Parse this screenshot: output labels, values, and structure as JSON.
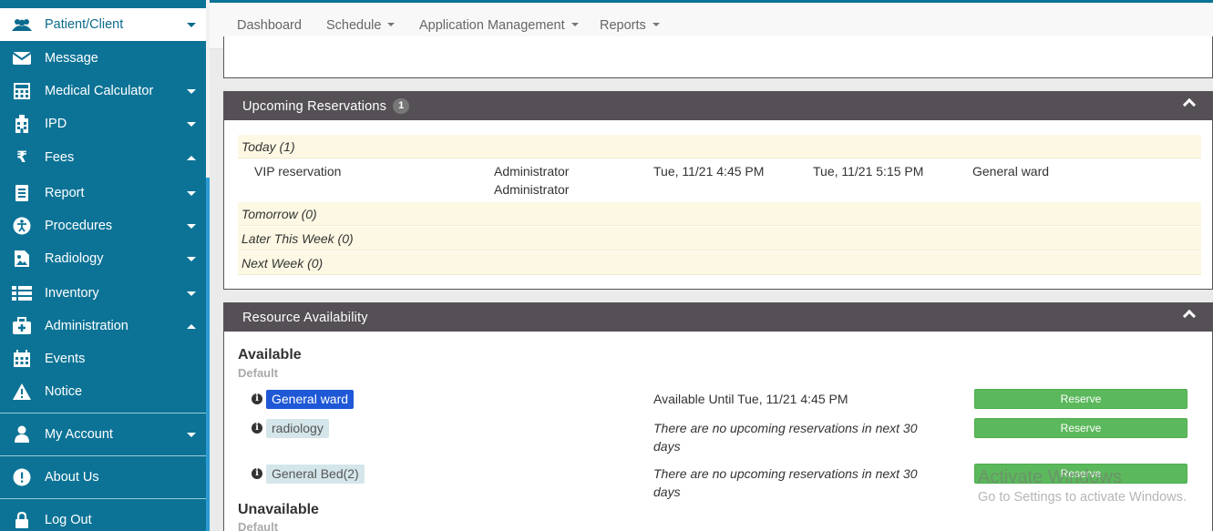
{
  "sidebar": {
    "items": [
      {
        "label": "Patient/Client",
        "icon": "users-icon",
        "caret": "down"
      },
      {
        "label": "Message",
        "icon": "envelope-icon",
        "caret": ""
      },
      {
        "label": "Medical Calculator",
        "icon": "calculator-icon",
        "caret": "down"
      },
      {
        "label": "IPD",
        "icon": "hospital-icon",
        "caret": "down"
      },
      {
        "label": "Fees",
        "icon": "rupee-icon",
        "caret": "up"
      },
      {
        "label": "Report",
        "icon": "book-icon",
        "caret": "down"
      },
      {
        "label": "Procedures",
        "icon": "accessibility-icon",
        "caret": "down"
      },
      {
        "label": "Radiology",
        "icon": "image-file-icon",
        "caret": "down"
      },
      {
        "label": "Inventory",
        "icon": "list-icon",
        "caret": "down"
      },
      {
        "label": "Administration",
        "icon": "medkit-icon",
        "caret": "up"
      },
      {
        "label": "Events",
        "icon": "calendar-icon",
        "caret": ""
      },
      {
        "label": "Notice",
        "icon": "warning-icon",
        "caret": ""
      },
      {
        "label": "My Account",
        "icon": "user-icon",
        "caret": "down"
      },
      {
        "label": "About Us",
        "icon": "info-circle-icon",
        "caret": ""
      },
      {
        "label": "Log Out",
        "icon": "lock-icon",
        "caret": ""
      }
    ]
  },
  "topnav": {
    "dashboard": "Dashboard",
    "schedule": "Schedule",
    "app_mgmt": "Application Management",
    "reports": "Reports"
  },
  "reservations": {
    "title": "Upcoming Reservations",
    "count": "1",
    "groups": {
      "today": "Today (1)",
      "tomorrow": "Tomorrow (0)",
      "later": "Later This Week (0)",
      "next": "Next Week (0)"
    },
    "row": {
      "name": "VIP reservation",
      "owner_line1": "Administrator",
      "owner_line2": "Administrator",
      "start": "Tue, 11/21 4:45 PM",
      "end": "Tue, 11/21 5:15 PM",
      "resource": "General ward"
    }
  },
  "availability": {
    "title": "Resource Availability",
    "available_heading": "Available",
    "available_sub": "Default",
    "unavailable_heading": "Unavailable",
    "unavailable_sub": "Default",
    "resources": [
      {
        "name": "General ward",
        "status": "Available Until Tue, 11/21 4:45 PM",
        "button": "Reserve"
      },
      {
        "name": "radiology",
        "status": "There are no upcoming reservations in next 30 days",
        "button": "Reserve"
      },
      {
        "name": "General Bed(2)",
        "status": "There are no upcoming reservations in next 30 days",
        "button": "Reserve"
      }
    ]
  },
  "watermark": {
    "line1": "Activate Windows",
    "line2": "Go to Settings to activate Windows."
  },
  "colors": {
    "sidebar": "#0c7396",
    "panel_header": "#555055",
    "group_row": "#fcf8e3",
    "reserve_button": "#5cb85c",
    "selected_resource": "#1e58d6"
  }
}
